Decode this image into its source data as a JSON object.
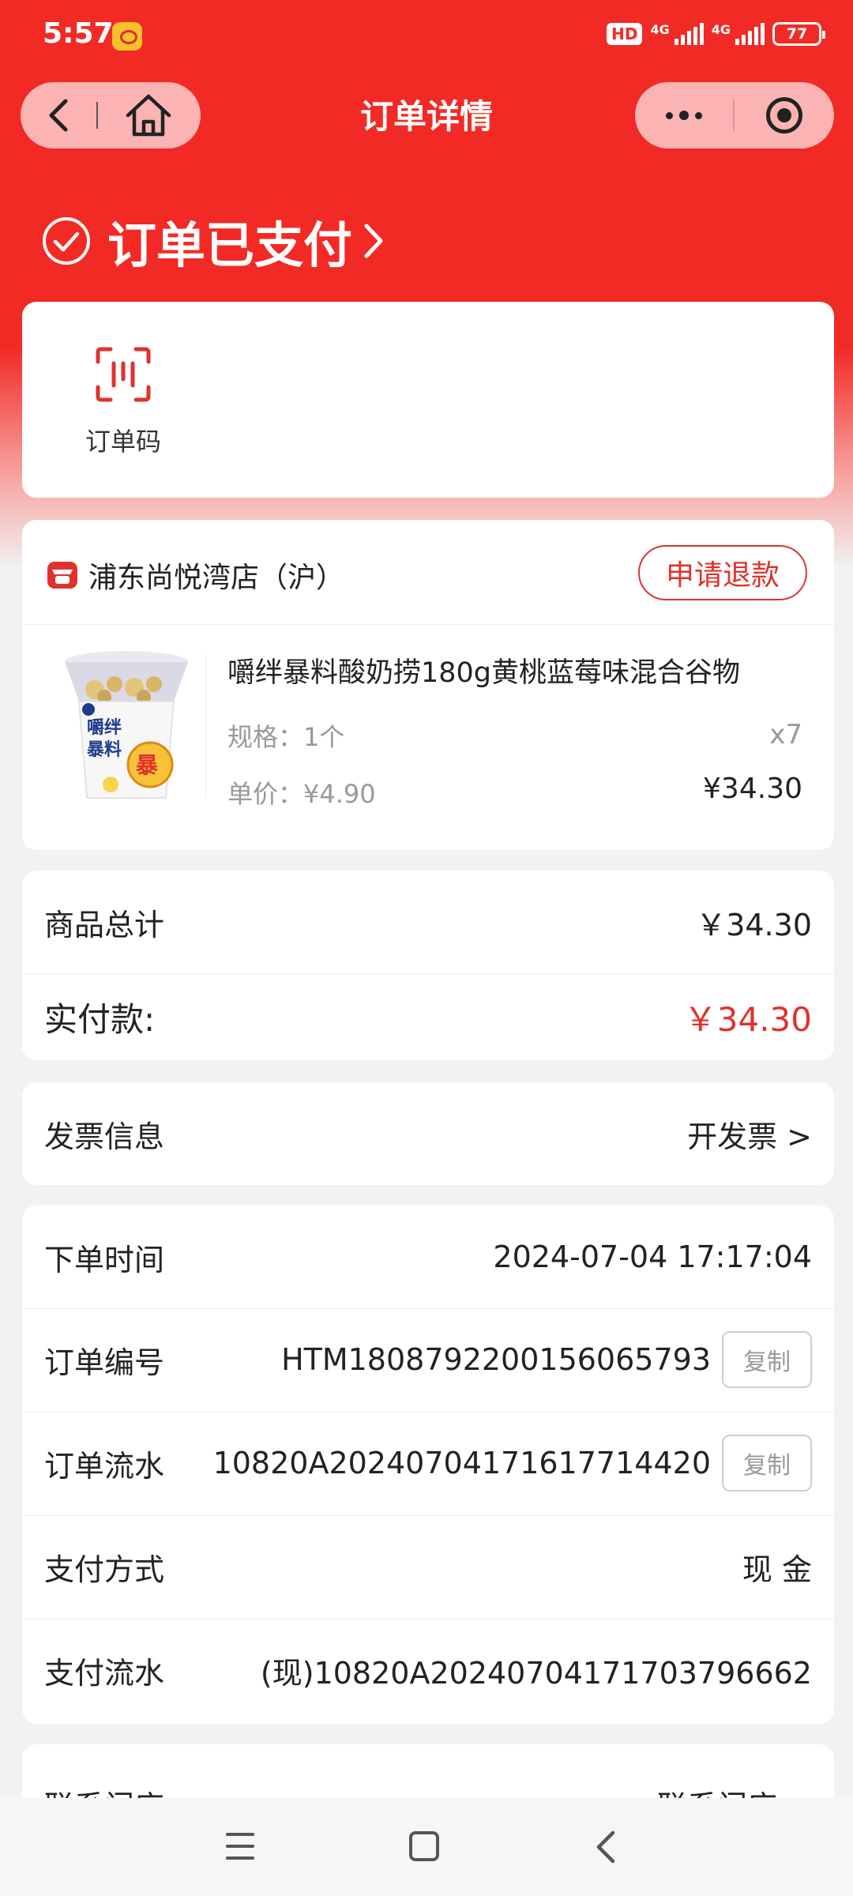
{
  "status_bar": {
    "time": "5:57",
    "hd_badge": "HD",
    "net1": "4G",
    "net2": "4G",
    "battery": "77"
  },
  "nav": {
    "title": "订单详情"
  },
  "order_status": {
    "text": "订单已支付",
    "chevron": ">"
  },
  "order_code": {
    "label": "订单码"
  },
  "store": {
    "name": "浦东尚悦湾店（沪）",
    "refund_label": "申请退款",
    "product": {
      "name": "嚼绊暴料酸奶捞180g黄桃蓝莓味混合谷物",
      "spec": "规格：1个",
      "qty": "x7",
      "unit_price": "单价：¥4.90",
      "total": "¥34.30",
      "image_text": {
        "brand": "嚼绊暴料",
        "badge": "暴"
      }
    }
  },
  "totals": {
    "subtotal_label": "商品总计",
    "subtotal_value": "￥34.30",
    "paid_label": "实付款:",
    "paid_value": "￥34.30",
    "paid_color": "#e0322b"
  },
  "invoice": {
    "label": "发票信息",
    "action": "开发票 >"
  },
  "info": {
    "order_time_label": "下单时间",
    "order_time_value": "2024-07-04 17:17:04",
    "order_no_label": "订单编号",
    "order_no_value": "HTM1808792200156065793",
    "serial_label": "订单流水",
    "serial_value": "10820A20240704171617714420",
    "copy_label": "复制",
    "pay_method_label": "支付方式",
    "pay_method_value": "现 金",
    "pay_serial_label": "支付流水",
    "pay_serial_value": "(现)10820A20240704171703796662"
  },
  "contact": {
    "label": "联系门店",
    "action": "联系门店 >"
  },
  "colors": {
    "primary_red": "#f22a25",
    "accent_red": "#e0322b"
  }
}
